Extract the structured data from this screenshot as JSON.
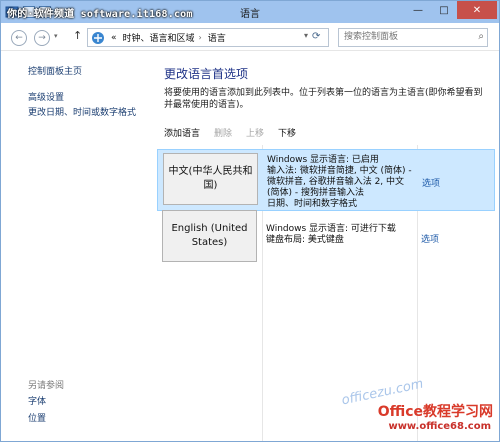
{
  "window": {
    "title": "语言",
    "watermark": "你的·软件频道 software.it168.com",
    "buttons": {
      "minimize": "—",
      "maximize": "□",
      "close": "✕"
    }
  },
  "nav": {
    "back": "←",
    "forward": "→",
    "up": "↑",
    "breadcrumb": [
      "«",
      "时钟、语言和区域",
      "语言"
    ],
    "search_placeholder": "搜索控制面板"
  },
  "left_pane": {
    "home": "控制面板主页",
    "links": [
      "高级设置",
      "更改日期、时间或数字格式"
    ],
    "see_also_heading": "另请参阅",
    "see_also": [
      "字体",
      "位置"
    ]
  },
  "main": {
    "heading": "更改语言首选项",
    "description": "将要使用的语言添加到此列表中。位于列表第一位的语言为主语言(即你希望看到并最常使用的语言)。",
    "toolbar": {
      "add": "添加语言",
      "remove": "删除",
      "up": "上移",
      "down": "下移"
    },
    "languages": [
      {
        "name": "中文(中华人民共和国)",
        "info": "Windows 显示语言: 已启用\n输入法: 微软拼音简捷, 中文 (简体) - 微软拼音, 谷歌拼音输入法 2, 中文 (简体) - 搜狗拼音输入法\n日期、时间和数字格式",
        "options": "选项",
        "selected": true
      },
      {
        "name": "English (United States)",
        "info": "Windows 显示语言: 可进行下载\n键盘布局: 美式键盘",
        "options": "选项",
        "selected": false
      }
    ]
  },
  "brand_watermark": {
    "faint": "officezu.com",
    "big": "Office教程学习网",
    "url": "www.office68.com"
  },
  "colors": {
    "accent": "#1e3287",
    "selection": "#cde8ff",
    "selection_border": "#99d1ff"
  }
}
